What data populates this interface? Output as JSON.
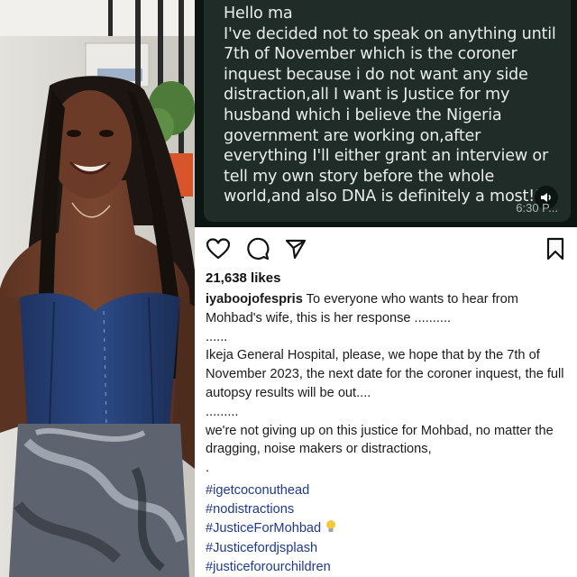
{
  "chat": {
    "message": "Hello ma\nI've decided not to speak on anything until 7th of November which is the coroner inquest because i do not want any side distraction,all I want is Justice for my husband which i believe the Nigeria government are working on,after everything I'll either grant an interview or tell my own story before the whole world,and also DNA is definitely a most!!!",
    "time": "6:30 P..."
  },
  "post": {
    "likes": "21,638 likes",
    "username": "iyaboojofespris",
    "caption_intro": " To everyone who wants to hear from Mohbad's wife, this is her response ..........",
    "dots1": "......",
    "paragraph1": "Ikeja General Hospital, please, we hope that by the 7th of November 2023, the next date for the coroner inquest, the full autopsy results will be out....",
    "dots2": ".........",
    "paragraph2": "we're not giving up on this justice for Mohbad, no matter the dragging, noise makers or distractions,",
    "dots3": ".",
    "hashtags": [
      "#igetcoconuthead",
      "#nodistractions",
      "#JusticeForMohbad",
      "#Justicefordjsplash",
      "#justiceforourchildren"
    ]
  },
  "icons": [
    "heart-icon",
    "comment-icon",
    "share-icon",
    "bookmark-icon",
    "speaker-icon",
    "lightbulb-emoji"
  ]
}
